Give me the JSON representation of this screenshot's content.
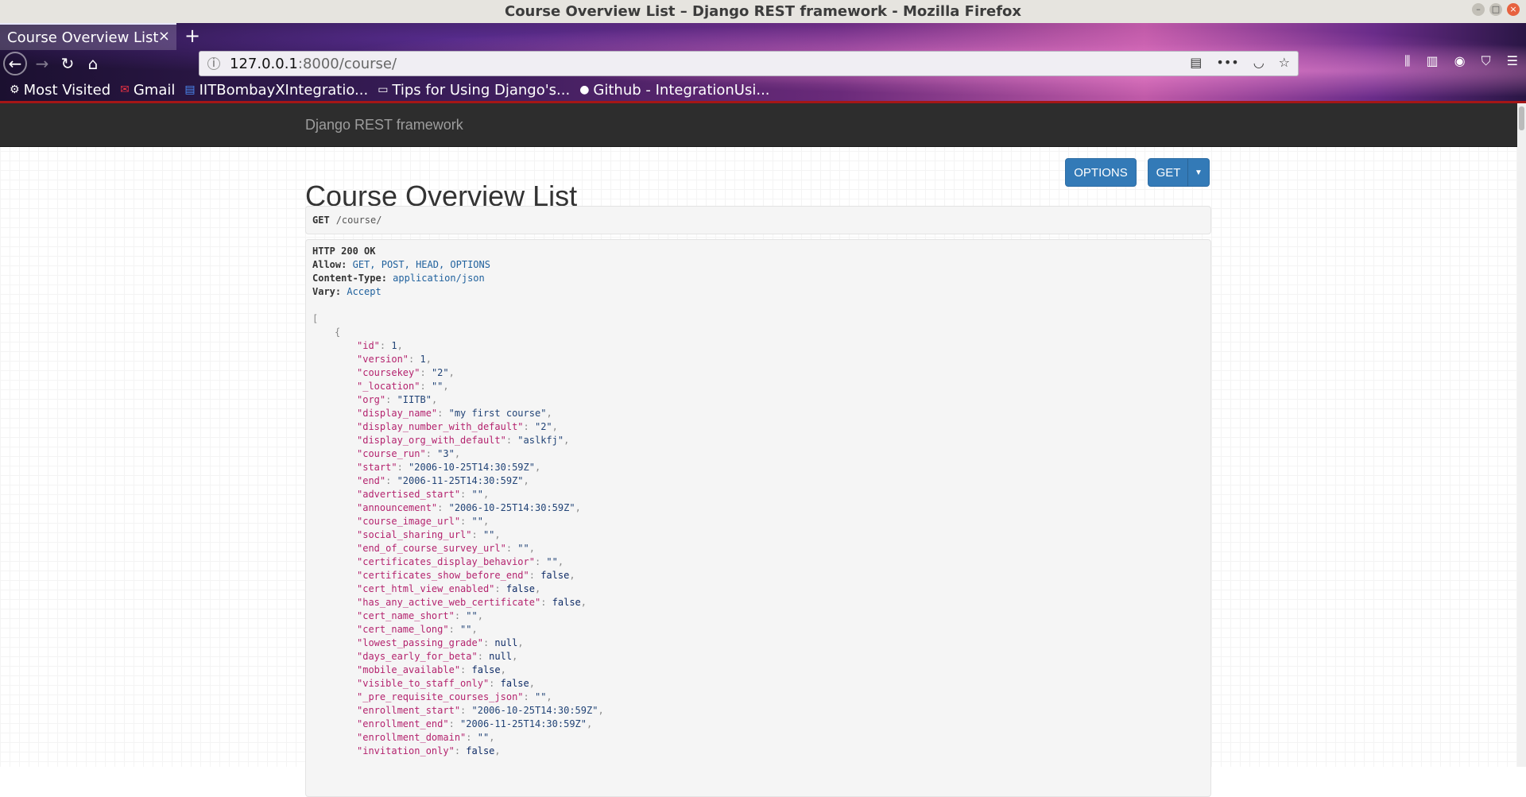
{
  "window": {
    "title": "Course Overview List – Django REST framework - Mozilla Firefox"
  },
  "browser": {
    "tab_label": "Course Overview List",
    "tab_close": "×",
    "new_tab": "+",
    "url_host": "127.0.0.1",
    "url_rest": ":8000/course/",
    "bookmarks": [
      {
        "label": "Most Visited",
        "icon": "gear-icon"
      },
      {
        "label": "Gmail",
        "icon": "gmail-icon"
      },
      {
        "label": "IITBombayXIntegratio...",
        "icon": "docs-icon"
      },
      {
        "label": "Tips for Using Django's...",
        "icon": "page-icon"
      },
      {
        "label": "Github - IntegrationUsi...",
        "icon": "github-icon"
      }
    ]
  },
  "navbar": {
    "brand": "Django REST framework"
  },
  "page": {
    "title": "Course Overview List",
    "options_label": "OPTIONS",
    "get_label": "GET"
  },
  "request": {
    "method": "GET",
    "path": "/course/"
  },
  "response": {
    "status": "HTTP 200 OK",
    "headers": [
      {
        "key": "Allow:",
        "value": "GET, POST, HEAD, OPTIONS"
      },
      {
        "key": "Content-Type:",
        "value": "application/json"
      },
      {
        "key": "Vary:",
        "value": "Accept"
      }
    ],
    "open_bracket": "[",
    "open_brace": "{",
    "fields": [
      {
        "key": "\"id\"",
        "value": "1",
        "type": "num"
      },
      {
        "key": "\"version\"",
        "value": "1",
        "type": "num"
      },
      {
        "key": "\"coursekey\"",
        "value": "\"2\"",
        "type": "str"
      },
      {
        "key": "\"_location\"",
        "value": "\"\"",
        "type": "str"
      },
      {
        "key": "\"org\"",
        "value": "\"IITB\"",
        "type": "str"
      },
      {
        "key": "\"display_name\"",
        "value": "\"my first course\"",
        "type": "str"
      },
      {
        "key": "\"display_number_with_default\"",
        "value": "\"2\"",
        "type": "str"
      },
      {
        "key": "\"display_org_with_default\"",
        "value": "\"aslkfj\"",
        "type": "str"
      },
      {
        "key": "\"course_run\"",
        "value": "\"3\"",
        "type": "str"
      },
      {
        "key": "\"start\"",
        "value": "\"2006-10-25T14:30:59Z\"",
        "type": "str"
      },
      {
        "key": "\"end\"",
        "value": "\"2006-11-25T14:30:59Z\"",
        "type": "str"
      },
      {
        "key": "\"advertised_start\"",
        "value": "\"\"",
        "type": "str"
      },
      {
        "key": "\"announcement\"",
        "value": "\"2006-10-25T14:30:59Z\"",
        "type": "str"
      },
      {
        "key": "\"course_image_url\"",
        "value": "\"\"",
        "type": "str"
      },
      {
        "key": "\"social_sharing_url\"",
        "value": "\"\"",
        "type": "str"
      },
      {
        "key": "\"end_of_course_survey_url\"",
        "value": "\"\"",
        "type": "str"
      },
      {
        "key": "\"certificates_display_behavior\"",
        "value": "\"\"",
        "type": "str"
      },
      {
        "key": "\"certificates_show_before_end\"",
        "value": "false",
        "type": "lit"
      },
      {
        "key": "\"cert_html_view_enabled\"",
        "value": "false",
        "type": "lit"
      },
      {
        "key": "\"has_any_active_web_certificate\"",
        "value": "false",
        "type": "lit"
      },
      {
        "key": "\"cert_name_short\"",
        "value": "\"\"",
        "type": "str"
      },
      {
        "key": "\"cert_name_long\"",
        "value": "\"\"",
        "type": "str"
      },
      {
        "key": "\"lowest_passing_grade\"",
        "value": "null",
        "type": "lit"
      },
      {
        "key": "\"days_early_for_beta\"",
        "value": "null",
        "type": "lit"
      },
      {
        "key": "\"mobile_available\"",
        "value": "false",
        "type": "lit"
      },
      {
        "key": "\"visible_to_staff_only\"",
        "value": "false",
        "type": "lit"
      },
      {
        "key": "\"_pre_requisite_courses_json\"",
        "value": "\"\"",
        "type": "str"
      },
      {
        "key": "\"enrollment_start\"",
        "value": "\"2006-10-25T14:30:59Z\"",
        "type": "str"
      },
      {
        "key": "\"enrollment_end\"",
        "value": "\"2006-11-25T14:30:59Z\"",
        "type": "str"
      },
      {
        "key": "\"enrollment_domain\"",
        "value": "\"\"",
        "type": "str"
      },
      {
        "key": "\"invitation_only\"",
        "value": "false",
        "type": "lit"
      }
    ]
  }
}
